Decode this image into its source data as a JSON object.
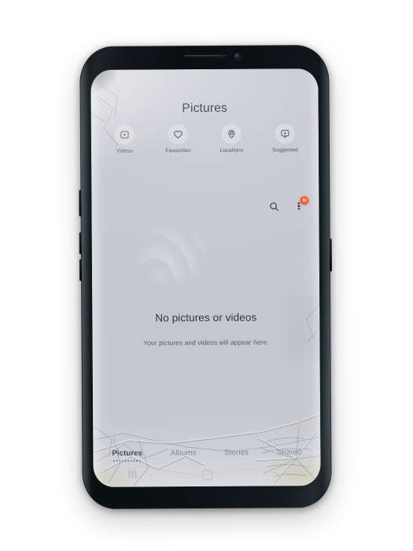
{
  "device": {
    "body_color": "#0c1215",
    "hardware": {
      "earpiece": "earpiece-speaker",
      "front_camera": "front-camera",
      "proximity_sensor": "proximity-sensor",
      "buttons": [
        "bixby-button",
        "volume-down-button",
        "volume-up-button",
        "power-button"
      ]
    },
    "condition": "cracked-screen"
  },
  "screen": {
    "background_color": "#c8c9d0",
    "app": {
      "title": "Pictures",
      "quick_filters": [
        {
          "label": "Videos",
          "icon": "video-icon"
        },
        {
          "label": "Favourites",
          "icon": "heart-icon"
        },
        {
          "label": "Locations",
          "icon": "location-pin-icon"
        },
        {
          "label": "Suggested",
          "icon": "suggested-sparkle-icon"
        }
      ],
      "actions": {
        "search_icon": "search-icon",
        "overflow_icon": "more-options-icon",
        "badge_text": "N",
        "badge_color": "#f05a28"
      },
      "empty_state": {
        "title": "No pictures or videos",
        "subtitle": "Your pictures and videos will appear here."
      },
      "tabs": [
        {
          "label": "Pictures",
          "active": true
        },
        {
          "label": "Albums",
          "active": false
        },
        {
          "label": "Stories",
          "active": false
        },
        {
          "label": "Shared",
          "active": false
        }
      ],
      "navigation": {
        "home_indicator": "home-button-indicator",
        "recents_indicator": "recents-indicator"
      }
    }
  }
}
